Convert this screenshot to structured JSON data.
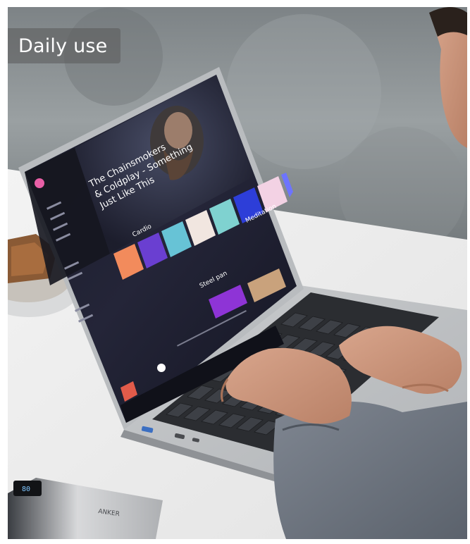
{
  "caption": {
    "label": "Daily use"
  },
  "screen": {
    "hero_title_line1": "The Chainsmokers",
    "hero_title_line2": "& Coldplay - Something",
    "hero_title_line3": "Just Like This",
    "section_one": "Cardio",
    "section_two": "Meditation",
    "section_three": "Steel pan"
  },
  "brand": {
    "power_bank_mark": "ANKER"
  }
}
